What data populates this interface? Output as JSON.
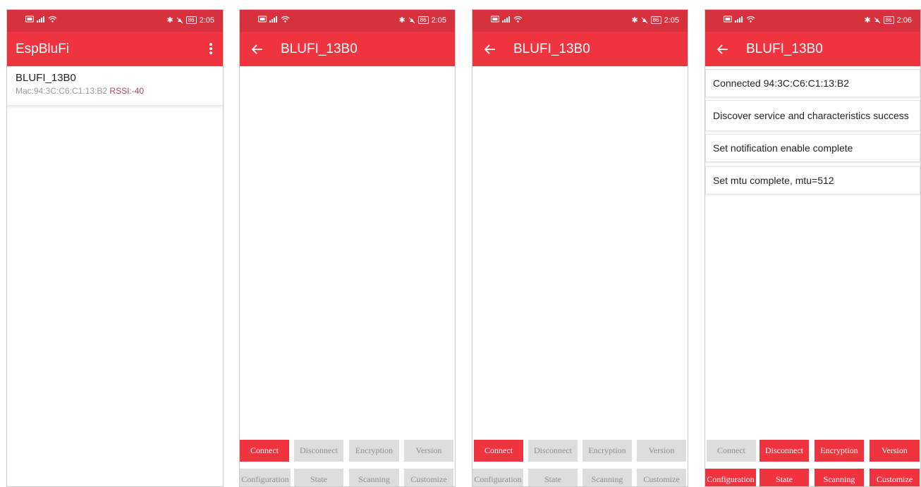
{
  "status_bar": {
    "time_left3": "2:05",
    "time_right": "2:06",
    "battery": "86",
    "signal_glyph": "HD",
    "bt_glyph": "✱"
  },
  "screen1": {
    "title": "EspBluFi",
    "device": {
      "name": "BLUFI_13B0",
      "mac": "Mac:94:3C:C6:C1:13:B2",
      "rssi": "RSSI:-40"
    }
  },
  "screen2": {
    "title": "BLUFI_13B0"
  },
  "screen3": {
    "title": "BLUFI_13B0"
  },
  "screen4": {
    "title": "BLUFI_13B0",
    "log": [
      "Connected 94:3C:C6:C1:13:B2",
      "Discover service and characteristics success",
      "Set notification enable  complete",
      "Set mtu complete, mtu=512"
    ]
  },
  "buttons": {
    "row1": [
      "Connect",
      "Disconnect",
      "Encryption",
      "Version"
    ],
    "row2": [
      "Configuration",
      "State",
      "Scanning",
      "Customize"
    ]
  },
  "colors": {
    "status": "#d7313e",
    "appbar": "#f0343f",
    "button_on": "#f0343f",
    "button_off": "#dddddd"
  }
}
